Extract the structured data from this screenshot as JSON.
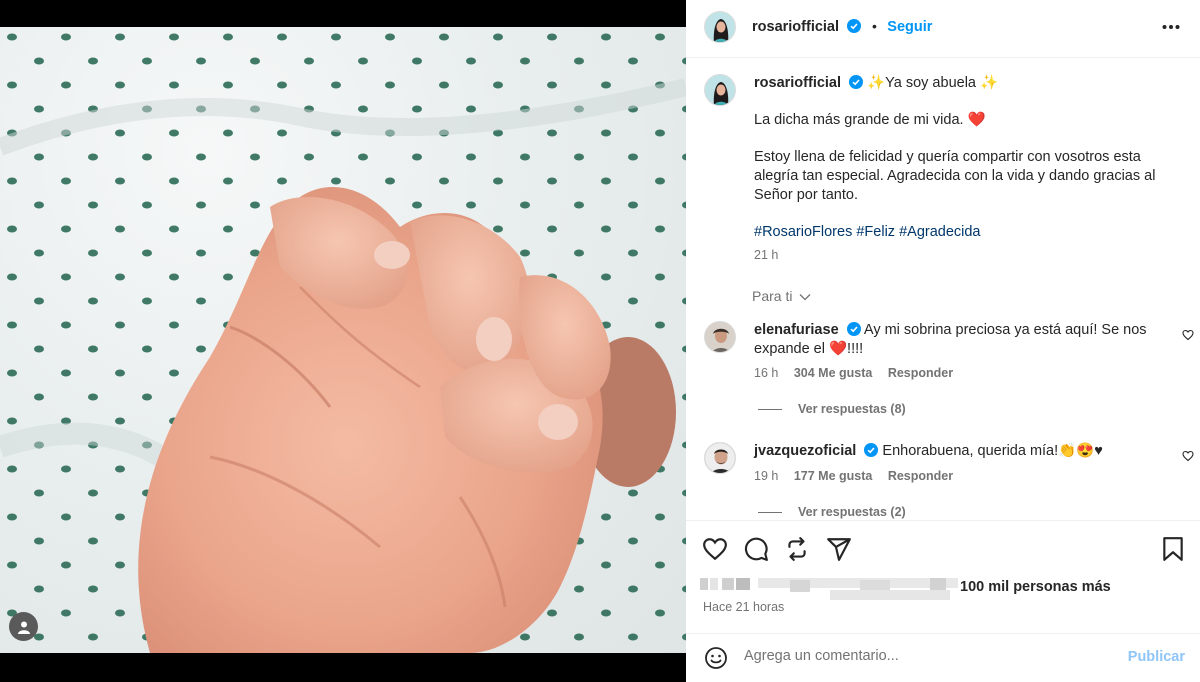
{
  "post": {
    "author": "rosariofficial",
    "follow_label": "Seguir",
    "more_icon": "more-horizontal-icon",
    "caption_headline": "Ya soy abuela",
    "caption_line2": "La dicha más grande de mi vida.",
    "caption_body": "Estoy llena de felicidad y quería compartir con vosotros esta alegría tan especial. Agradecida con la vida y dando gracias al Señor por tanto.",
    "hashtags": [
      "#RosarioFlores",
      "#Feliz",
      "#Agradecida"
    ],
    "caption_time": "21 h",
    "para_ti": "Para ti",
    "likes_suffix": "100 mil personas más",
    "posted_ago": "Hace 21 horas"
  },
  "comments": [
    {
      "user": "elenafuriase",
      "text_a": "Ay mi sobrina preciosa ya está aquí! Se nos expande el",
      "text_b": "!!!!",
      "time": "16 h",
      "likes": "304 Me gusta",
      "reply": "Responder",
      "view_replies": "Ver respuestas (8)"
    },
    {
      "user": "jvazquezoficial",
      "text_a": "Enhorabuena, querida mía!",
      "text_b": "♥",
      "time": "19 h",
      "likes": "177 Me gusta",
      "reply": "Responder",
      "view_replies": "Ver respuestas (2)"
    }
  ],
  "comment_box": {
    "placeholder": "Agrega un comentario...",
    "publish_label": "Publicar"
  },
  "colors": {
    "accent_blue": "#0095f6",
    "hashtag_blue": "#00376b",
    "muted": "#737373",
    "heart_red": "#e0245e"
  }
}
